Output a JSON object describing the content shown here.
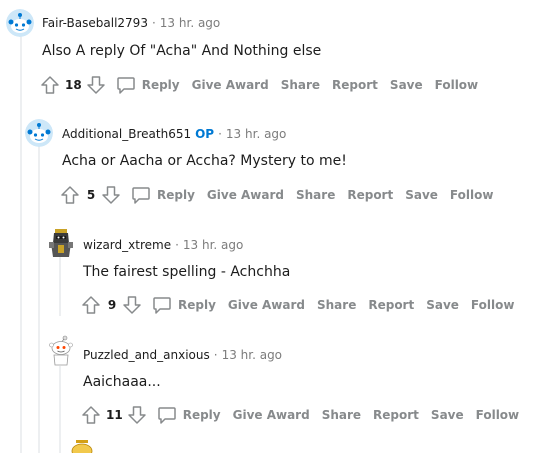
{
  "comments": [
    {
      "username": "Fair-Baseball2793",
      "op_badge": "",
      "time": "13 hr. ago",
      "body": "Also A reply Of \"Acha\" And Nothing else",
      "score": "18",
      "avatar_icon": "snoo-blue-avatar"
    },
    {
      "username": "Additional_Breath651",
      "op_badge": "OP",
      "time": "13 hr. ago",
      "body": "Acha or Aacha or Accha? Mystery to me!",
      "score": "5",
      "avatar_icon": "snoo-blue-avatar"
    },
    {
      "username": "wizard_xtreme",
      "op_badge": "",
      "time": "13 hr. ago",
      "body": "The fairest spelling - Achchha",
      "score": "9",
      "avatar_icon": "armored-snoo-avatar"
    },
    {
      "username": "Puzzled_and_anxious",
      "op_badge": "",
      "time": "13 hr. ago",
      "body": "Aaichaaa...",
      "score": "11",
      "avatar_icon": "white-snoo-avatar"
    }
  ],
  "actions": {
    "reply": "Reply",
    "give_award": "Give Award",
    "share": "Share",
    "report": "Report",
    "save": "Save",
    "follow": "Follow"
  },
  "separator": "·",
  "colors": {
    "op": "#0079d3",
    "muted": "#7c7c7c",
    "action": "#878a8c",
    "thread_line": "#edeff1"
  }
}
